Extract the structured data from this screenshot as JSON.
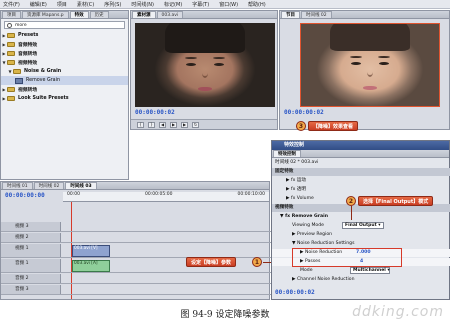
{
  "menu": [
    "文件(F)",
    "编辑(E)",
    "项目",
    "素材(C)",
    "序列(S)",
    "时间线(N)",
    "标记(M)",
    "字幕(T)",
    "窗口(W)",
    "帮助(H)"
  ],
  "project_panel": {
    "tabs": [
      "项目",
      "资源库 Mapans.p",
      "特效",
      "历史"
    ],
    "search_value": "more",
    "tree": [
      {
        "label": "Presets",
        "type": "folder"
      },
      {
        "label": "音频特效",
        "type": "folder"
      },
      {
        "label": "音频转场",
        "type": "folder"
      },
      {
        "label": "视频特效",
        "type": "folder",
        "expanded": true
      },
      {
        "label": "Noise & Grain",
        "type": "folder",
        "expanded": true
      },
      {
        "label": "Remove Grain",
        "type": "effect",
        "selected": true
      },
      {
        "label": "视频转场",
        "type": "folder"
      },
      {
        "label": "Look Suite Presets",
        "type": "folder"
      }
    ]
  },
  "source_monitor": {
    "tabs": [
      "素材源",
      "003.avi"
    ],
    "timecode": "00:00:00:02",
    "tab_label": "素材源 003.avi"
  },
  "program_monitor": {
    "tabs": [
      "节目",
      "时间线 02"
    ],
    "timecode": "00:00:00:02"
  },
  "timeline": {
    "tabs": [
      "时间线 01",
      "时间线 02",
      "时间线 03"
    ],
    "timecode": "00:00:00:00",
    "ruler": [
      "00:00",
      "00:00:05:00",
      "00:00:10:00"
    ],
    "tracks": [
      {
        "name": "视频 3"
      },
      {
        "name": "视频 2"
      },
      {
        "name": "视频 1",
        "clip": "003.avi [V]"
      },
      {
        "name": "音频 1",
        "clip": "003.avi [A]"
      },
      {
        "name": "音频 2"
      },
      {
        "name": "音频 3"
      }
    ]
  },
  "effect_controls": {
    "title": "特效控制",
    "tab": "特效控制",
    "clip_label": "时间线 02 * 003.avi",
    "sections": {
      "fixed": "固定特效",
      "motion": "运动",
      "opacity": "透明",
      "volume": "Volume",
      "video_effects": "视频特效",
      "effect_name": "Remove Grain"
    },
    "params": {
      "viewing_mode_label": "Viewing Mode",
      "viewing_mode_value": "Final Output",
      "preview_region": "Preview Region",
      "noise_settings": "Noise Reduction Settings",
      "noise_reduction_label": "Noise Reduction",
      "noise_reduction_value": "7.000",
      "passes_label": "Passes",
      "passes_value": "4",
      "mode_label": "Mode",
      "mode_value": "Multichannel",
      "channel_noise": "Channel Noise Reduction"
    },
    "footer_timecode": "00:00:00:02"
  },
  "callouts": [
    {
      "num": "1",
      "text": "设定【降噪】参数"
    },
    {
      "num": "2",
      "text": "选择【Final Output】模式"
    },
    {
      "num": "3",
      "text": "【降噪】效果查看"
    }
  ],
  "caption": "图 94-9   设定降噪参数",
  "watermark": "ddking.com",
  "colors": {
    "timecode": "#2a56c6",
    "callout": "#d9492b",
    "highlight_box": "#d63a2a"
  }
}
